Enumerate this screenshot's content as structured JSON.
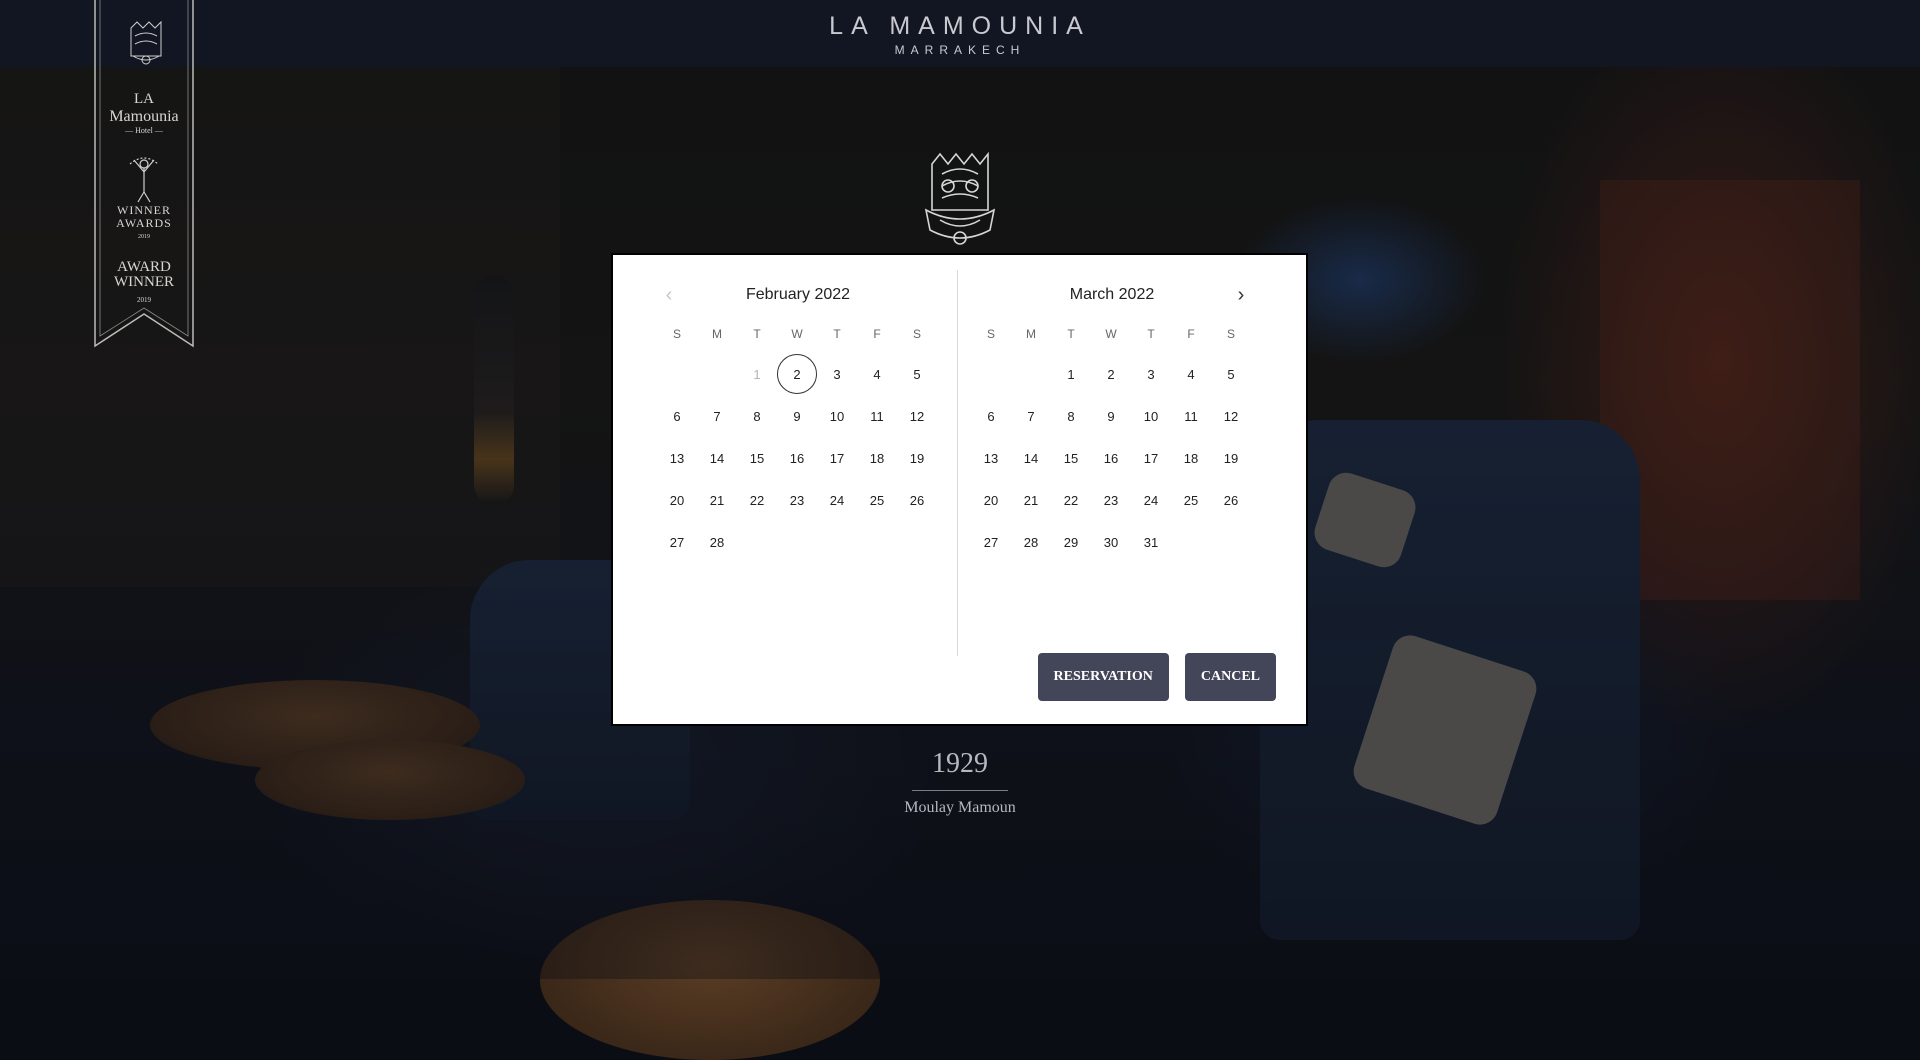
{
  "header": {
    "brand_name": "LA MAMOUNIA",
    "brand_city": "MARRAKECH"
  },
  "award_ribbon": {
    "la": "LA",
    "mamounia": "Mamounia",
    "hotel": "— Hotel —",
    "winner_line1": "WINNER",
    "winner_line2": "AWARDS",
    "year1": "2019",
    "award_line1": "AWARD",
    "award_line2": "WINNER",
    "year2": "2019"
  },
  "caption": {
    "year": "1929",
    "name": "Moulay Mamoun"
  },
  "calendar": {
    "weekday_labels": [
      "S",
      "M",
      "T",
      "W",
      "T",
      "F",
      "S"
    ],
    "months": [
      {
        "title": "February 2022",
        "leading_blanks": 2,
        "days": 28,
        "disabled_days": [
          1
        ],
        "selected_day": 2
      },
      {
        "title": "March 2022",
        "leading_blanks": 2,
        "days": 31,
        "disabled_days": [],
        "selected_day": null
      }
    ],
    "prev_icon": "chevron-left-icon",
    "next_icon": "chevron-right-icon"
  },
  "actions": {
    "reservation_label": "RESERVATION",
    "cancel_label": "CANCEL"
  },
  "colors": {
    "button_bg": "#434659",
    "header_bg": "#121624"
  }
}
